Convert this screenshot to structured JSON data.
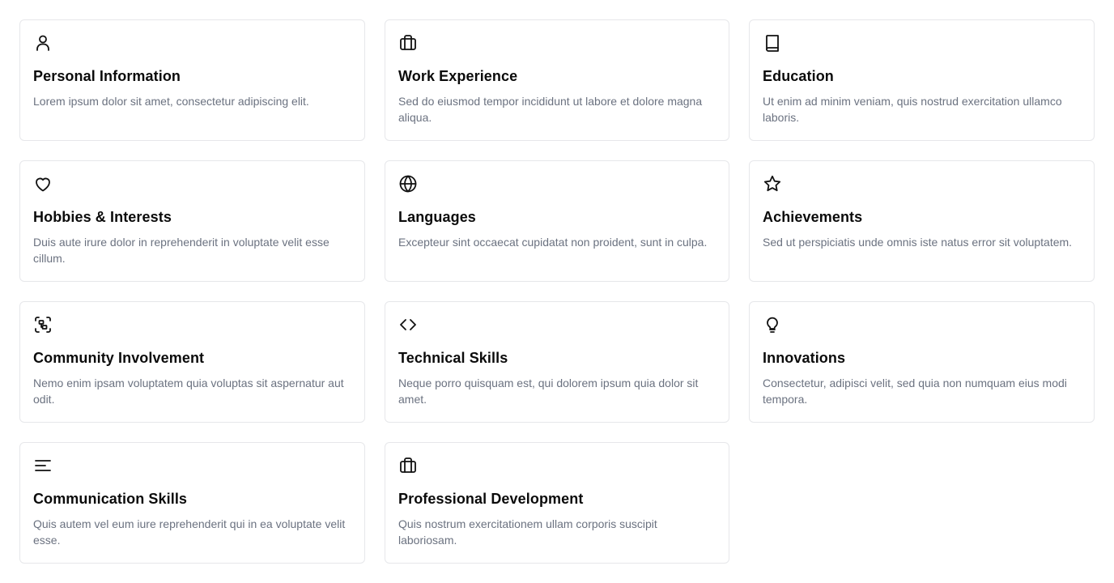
{
  "cards": [
    {
      "icon": "user-icon",
      "title": "Personal Information",
      "description": "Lorem ipsum dolor sit amet, consectetur adipiscing elit."
    },
    {
      "icon": "briefcase-icon",
      "title": "Work Experience",
      "description": "Sed do eiusmod tempor incididunt ut labore et dolore magna aliqua."
    },
    {
      "icon": "book-icon",
      "title": "Education",
      "description": "Ut enim ad minim veniam, quis nostrud exercitation ullamco laboris."
    },
    {
      "icon": "heart-icon",
      "title": "Hobbies & Interests",
      "description": "Duis aute irure dolor in reprehenderit in voluptate velit esse cillum."
    },
    {
      "icon": "globe-icon",
      "title": "Languages",
      "description": "Excepteur sint occaecat cupidatat non proident, sunt in culpa."
    },
    {
      "icon": "star-icon",
      "title": "Achievements",
      "description": "Sed ut perspiciatis unde omnis iste natus error sit voluptatem."
    },
    {
      "icon": "network-icon",
      "title": "Community Involvement",
      "description": "Nemo enim ipsam voluptatem quia voluptas sit aspernatur aut odit."
    },
    {
      "icon": "code-icon",
      "title": "Technical Skills",
      "description": "Neque porro quisquam est, qui dolorem ipsum quia dolor sit amet."
    },
    {
      "icon": "lightbulb-icon",
      "title": "Innovations",
      "description": "Consectetur, adipisci velit, sed quia non numquam eius modi tempora."
    },
    {
      "icon": "align-left-icon",
      "title": "Communication Skills",
      "description": "Quis autem vel eum iure reprehenderit qui in ea voluptate velit esse."
    },
    {
      "icon": "briefcase-icon",
      "title": "Professional Development",
      "description": "Quis nostrum exercitationem ullam corporis suscipit laboriosam."
    }
  ]
}
